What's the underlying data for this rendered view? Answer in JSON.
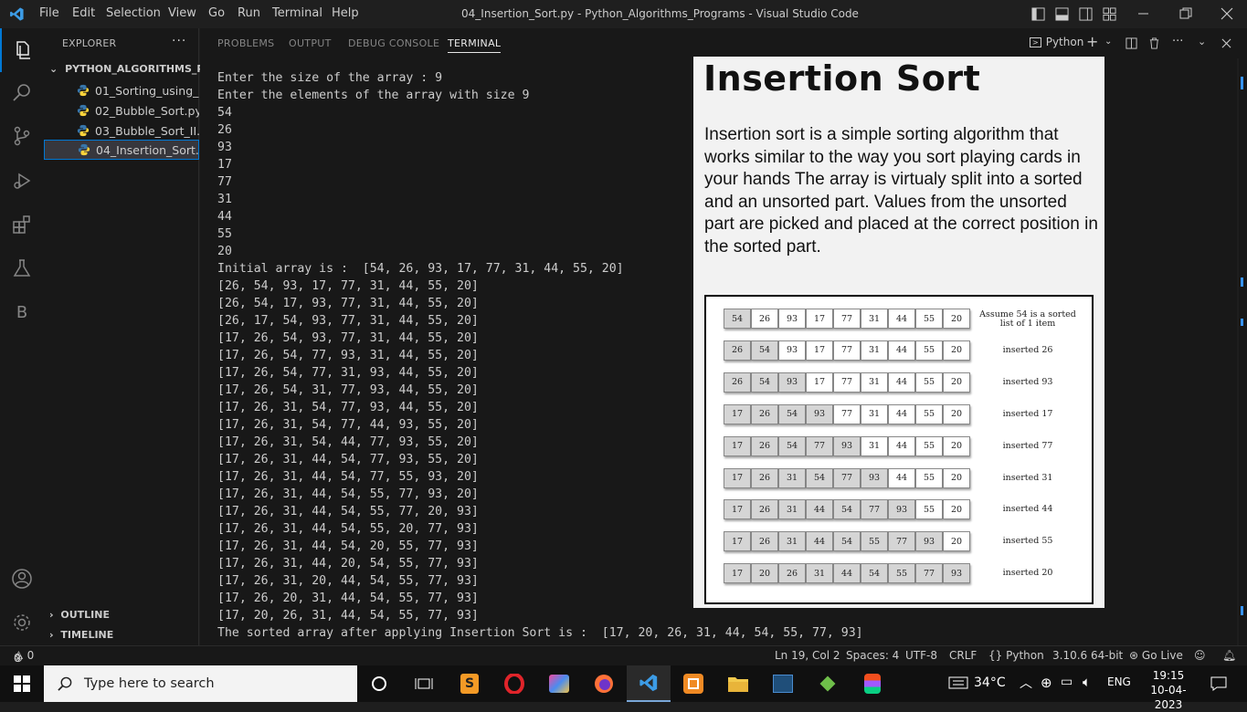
{
  "titlebar": {
    "menu": [
      "File",
      "Edit",
      "Selection",
      "View",
      "Go",
      "Run",
      "Terminal",
      "Help"
    ],
    "title": "04_Insertion_Sort.py - Python_Algorithms_Programs - Visual Studio Code"
  },
  "activity_icons": [
    "explorer-icon",
    "search-icon",
    "source-control-icon",
    "run-debug-icon",
    "extensions-icon",
    "testing-icon",
    "b-icon",
    "account-icon",
    "settings-gear-icon"
  ],
  "sidebar": {
    "header": "EXPLORER",
    "folder": "PYTHON_ALGORITHMS_P...",
    "files": [
      "01_Sorting_using_...",
      "02_Bubble_Sort.py",
      "03_Bubble_Sort_II....",
      "04_Insertion_Sort...."
    ],
    "outline": "OUTLINE",
    "timeline": "TIMELINE"
  },
  "panel": {
    "tabs": [
      "PROBLEMS",
      "OUTPUT",
      "DEBUG CONSOLE",
      "TERMINAL"
    ],
    "active_tab": "TERMINAL",
    "shell_label": "Python"
  },
  "terminal": {
    "lines": [
      "Enter the size of the array : 9",
      "Enter the elements of the array with size 9",
      "54",
      "26",
      "93",
      "17",
      "77",
      "31",
      "44",
      "55",
      "20",
      "Initial array is :  [54, 26, 93, 17, 77, 31, 44, 55, 20]",
      "[26, 54, 93, 17, 77, 31, 44, 55, 20]",
      "[26, 54, 17, 93, 77, 31, 44, 55, 20]",
      "[26, 17, 54, 93, 77, 31, 44, 55, 20]",
      "[17, 26, 54, 93, 77, 31, 44, 55, 20]",
      "[17, 26, 54, 77, 93, 31, 44, 55, 20]",
      "[17, 26, 54, 77, 31, 93, 44, 55, 20]",
      "[17, 26, 54, 31, 77, 93, 44, 55, 20]",
      "[17, 26, 31, 54, 77, 93, 44, 55, 20]",
      "[17, 26, 31, 54, 77, 44, 93, 55, 20]",
      "[17, 26, 31, 54, 44, 77, 93, 55, 20]",
      "[17, 26, 31, 44, 54, 77, 93, 55, 20]",
      "[17, 26, 31, 44, 54, 77, 55, 93, 20]",
      "[17, 26, 31, 44, 54, 55, 77, 93, 20]",
      "[17, 26, 31, 44, 54, 55, 77, 20, 93]",
      "[17, 26, 31, 44, 54, 55, 20, 77, 93]",
      "[17, 26, 31, 44, 54, 20, 55, 77, 93]",
      "[17, 26, 31, 44, 20, 54, 55, 77, 93]",
      "[17, 26, 31, 20, 44, 54, 55, 77, 93]",
      "[17, 26, 20, 31, 44, 54, 55, 77, 93]",
      "[17, 20, 26, 31, 44, 54, 55, 77, 93]",
      "The sorted array after applying Insertion Sort is :  [17, 20, 26, 31, 44, 54, 55, 77, 93]"
    ]
  },
  "overlay": {
    "title": "Insertion Sort",
    "body": "Insertion sort is a simple sorting algorithm that works similar to the way you sort playing cards in your hands The array is virtualy split into a sorted and an unsorted part. Values from the unsorted part are picked and placed at the correct position in the sorted part.",
    "rows": [
      {
        "values": [
          54,
          26,
          93,
          17,
          77,
          31,
          44,
          55,
          20
        ],
        "sorted_count": 1,
        "note": "Assume 54 is a sorted list of 1 item"
      },
      {
        "values": [
          26,
          54,
          93,
          17,
          77,
          31,
          44,
          55,
          20
        ],
        "sorted_count": 2,
        "note": "inserted 26"
      },
      {
        "values": [
          26,
          54,
          93,
          17,
          77,
          31,
          44,
          55,
          20
        ],
        "sorted_count": 3,
        "note": "inserted 93"
      },
      {
        "values": [
          17,
          26,
          54,
          93,
          77,
          31,
          44,
          55,
          20
        ],
        "sorted_count": 4,
        "note": "inserted 17"
      },
      {
        "values": [
          17,
          26,
          54,
          77,
          93,
          31,
          44,
          55,
          20
        ],
        "sorted_count": 5,
        "note": "inserted 77"
      },
      {
        "values": [
          17,
          26,
          31,
          54,
          77,
          93,
          44,
          55,
          20
        ],
        "sorted_count": 6,
        "note": "inserted 31"
      },
      {
        "values": [
          17,
          26,
          31,
          44,
          54,
          77,
          93,
          55,
          20
        ],
        "sorted_count": 7,
        "note": "inserted 44"
      },
      {
        "values": [
          17,
          26,
          31,
          44,
          54,
          55,
          77,
          93,
          20
        ],
        "sorted_count": 8,
        "note": "inserted 55"
      },
      {
        "values": [
          17,
          20,
          26,
          31,
          44,
          54,
          55,
          77,
          93
        ],
        "sorted_count": 9,
        "note": "inserted 20"
      }
    ]
  },
  "statusbar": {
    "errors": "0",
    "warnings": "0",
    "position": "Ln 19, Col 2",
    "spaces": "Spaces: 4",
    "encoding": "UTF-8",
    "eol": "CRLF",
    "language": "Python",
    "interpreter": "3.10.6 64-bit",
    "golive": "Go Live"
  },
  "taskbar": {
    "search_placeholder": "Type here to search",
    "temperature": "34°C",
    "language": "ENG",
    "time": "19:15",
    "date": "10-04-2023"
  },
  "colors": {
    "accent": "#0078d4",
    "background": "#1e1e1e",
    "panel": "#181818",
    "python_blue": "#3776ab",
    "python_yellow": "#ffd43b"
  }
}
